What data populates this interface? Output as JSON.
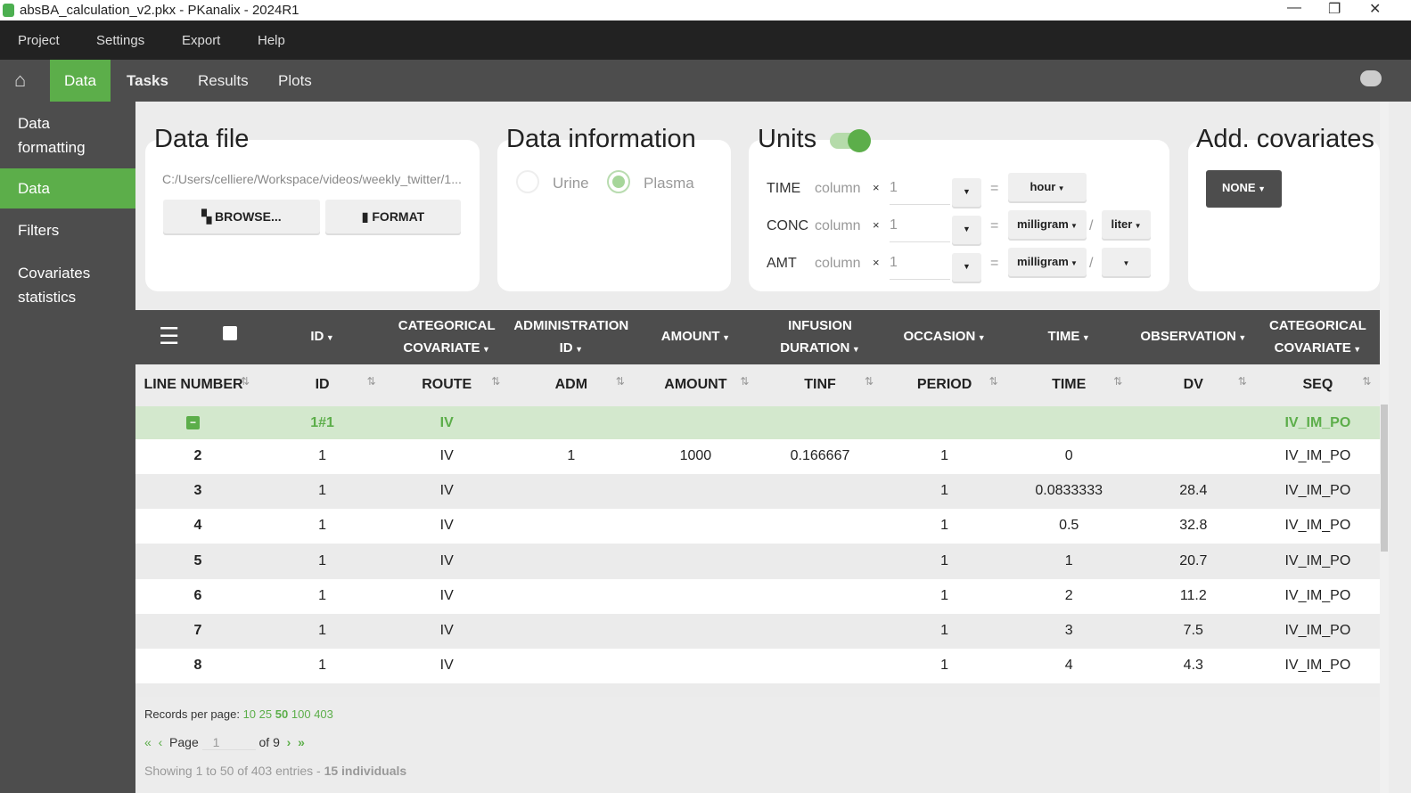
{
  "window": {
    "title": "absBA_calculation_v2.pkx - PKanalix - 2024R1",
    "minimize": "—",
    "restore": "❐",
    "close": "✕"
  },
  "menu": [
    "Project",
    "Settings",
    "Export",
    "Help"
  ],
  "tabs": [
    "Data",
    "Tasks",
    "Results",
    "Plots"
  ],
  "sidebar": [
    "Data formatting",
    "Data",
    "Filters",
    "Covariates statistics"
  ],
  "data_file": {
    "title": "Data file",
    "path": "C:/Users/celliere/Workspace/videos/weekly_twitter/1...",
    "browse": "BROWSE...",
    "format": "FORMAT"
  },
  "data_info": {
    "title": "Data information",
    "options": [
      "Urine",
      "Plasma"
    ],
    "selected": "Plasma"
  },
  "units": {
    "title": "Units",
    "toggle_on": true,
    "rows": [
      {
        "label": "TIME",
        "col": "column",
        "x": "×",
        "factor": "1",
        "eq": "=",
        "unit": "hour",
        "per": ""
      },
      {
        "label": "CONC",
        "col": "column",
        "x": "×",
        "factor": "1",
        "eq": "=",
        "unit": "milligram",
        "per": "liter"
      },
      {
        "label": "AMT",
        "col": "column",
        "x": "×",
        "factor": "1",
        "eq": "=",
        "unit": "milligram",
        "per": ""
      }
    ],
    "slash": "/"
  },
  "covariates": {
    "title": "Add. covariates",
    "button": "NONE"
  },
  "table": {
    "types": [
      "ID",
      "CATEGORICAL COVARIATE",
      "ADMINISTRATION ID",
      "AMOUNT",
      "INFUSION DURATION",
      "OCCASION",
      "TIME",
      "OBSERVATION",
      "CATEGORICAL COVARIATE"
    ],
    "headers": [
      "LINE NUMBER",
      "ID",
      "ROUTE",
      "ADM",
      "AMOUNT",
      "TINF",
      "PERIOD",
      "TIME",
      "DV",
      "SEQ"
    ],
    "group_row": [
      "",
      "1#1",
      "IV",
      "",
      "",
      "",
      "",
      "",
      "",
      "IV_IM_PO"
    ],
    "rows": [
      [
        "2",
        "1",
        "IV",
        "1",
        "1000",
        "0.166667",
        "1",
        "0",
        "",
        "IV_IM_PO"
      ],
      [
        "3",
        "1",
        "IV",
        "",
        "",
        "",
        "1",
        "0.0833333",
        "28.4",
        "IV_IM_PO"
      ],
      [
        "4",
        "1",
        "IV",
        "",
        "",
        "",
        "1",
        "0.5",
        "32.8",
        "IV_IM_PO"
      ],
      [
        "5",
        "1",
        "IV",
        "",
        "",
        "",
        "1",
        "1",
        "20.7",
        "IV_IM_PO"
      ],
      [
        "6",
        "1",
        "IV",
        "",
        "",
        "",
        "1",
        "2",
        "11.2",
        "IV_IM_PO"
      ],
      [
        "7",
        "1",
        "IV",
        "",
        "",
        "",
        "1",
        "3",
        "7.5",
        "IV_IM_PO"
      ],
      [
        "8",
        "1",
        "IV",
        "",
        "",
        "",
        "1",
        "4",
        "4.3",
        "IV_IM_PO"
      ]
    ]
  },
  "pagination": {
    "records_label": "Records per page:",
    "options": [
      "10",
      "25",
      "50",
      "100",
      "403"
    ],
    "selected": "50",
    "page_label": "Page",
    "page": "1",
    "of": "of 9",
    "showing": "Showing 1 to 50 of 403 entries - ",
    "individuals": "15 individuals"
  },
  "colors": {
    "accent": "#5cae4a",
    "dark": "#4d4d4d",
    "group_row": "#d3e8cd"
  }
}
